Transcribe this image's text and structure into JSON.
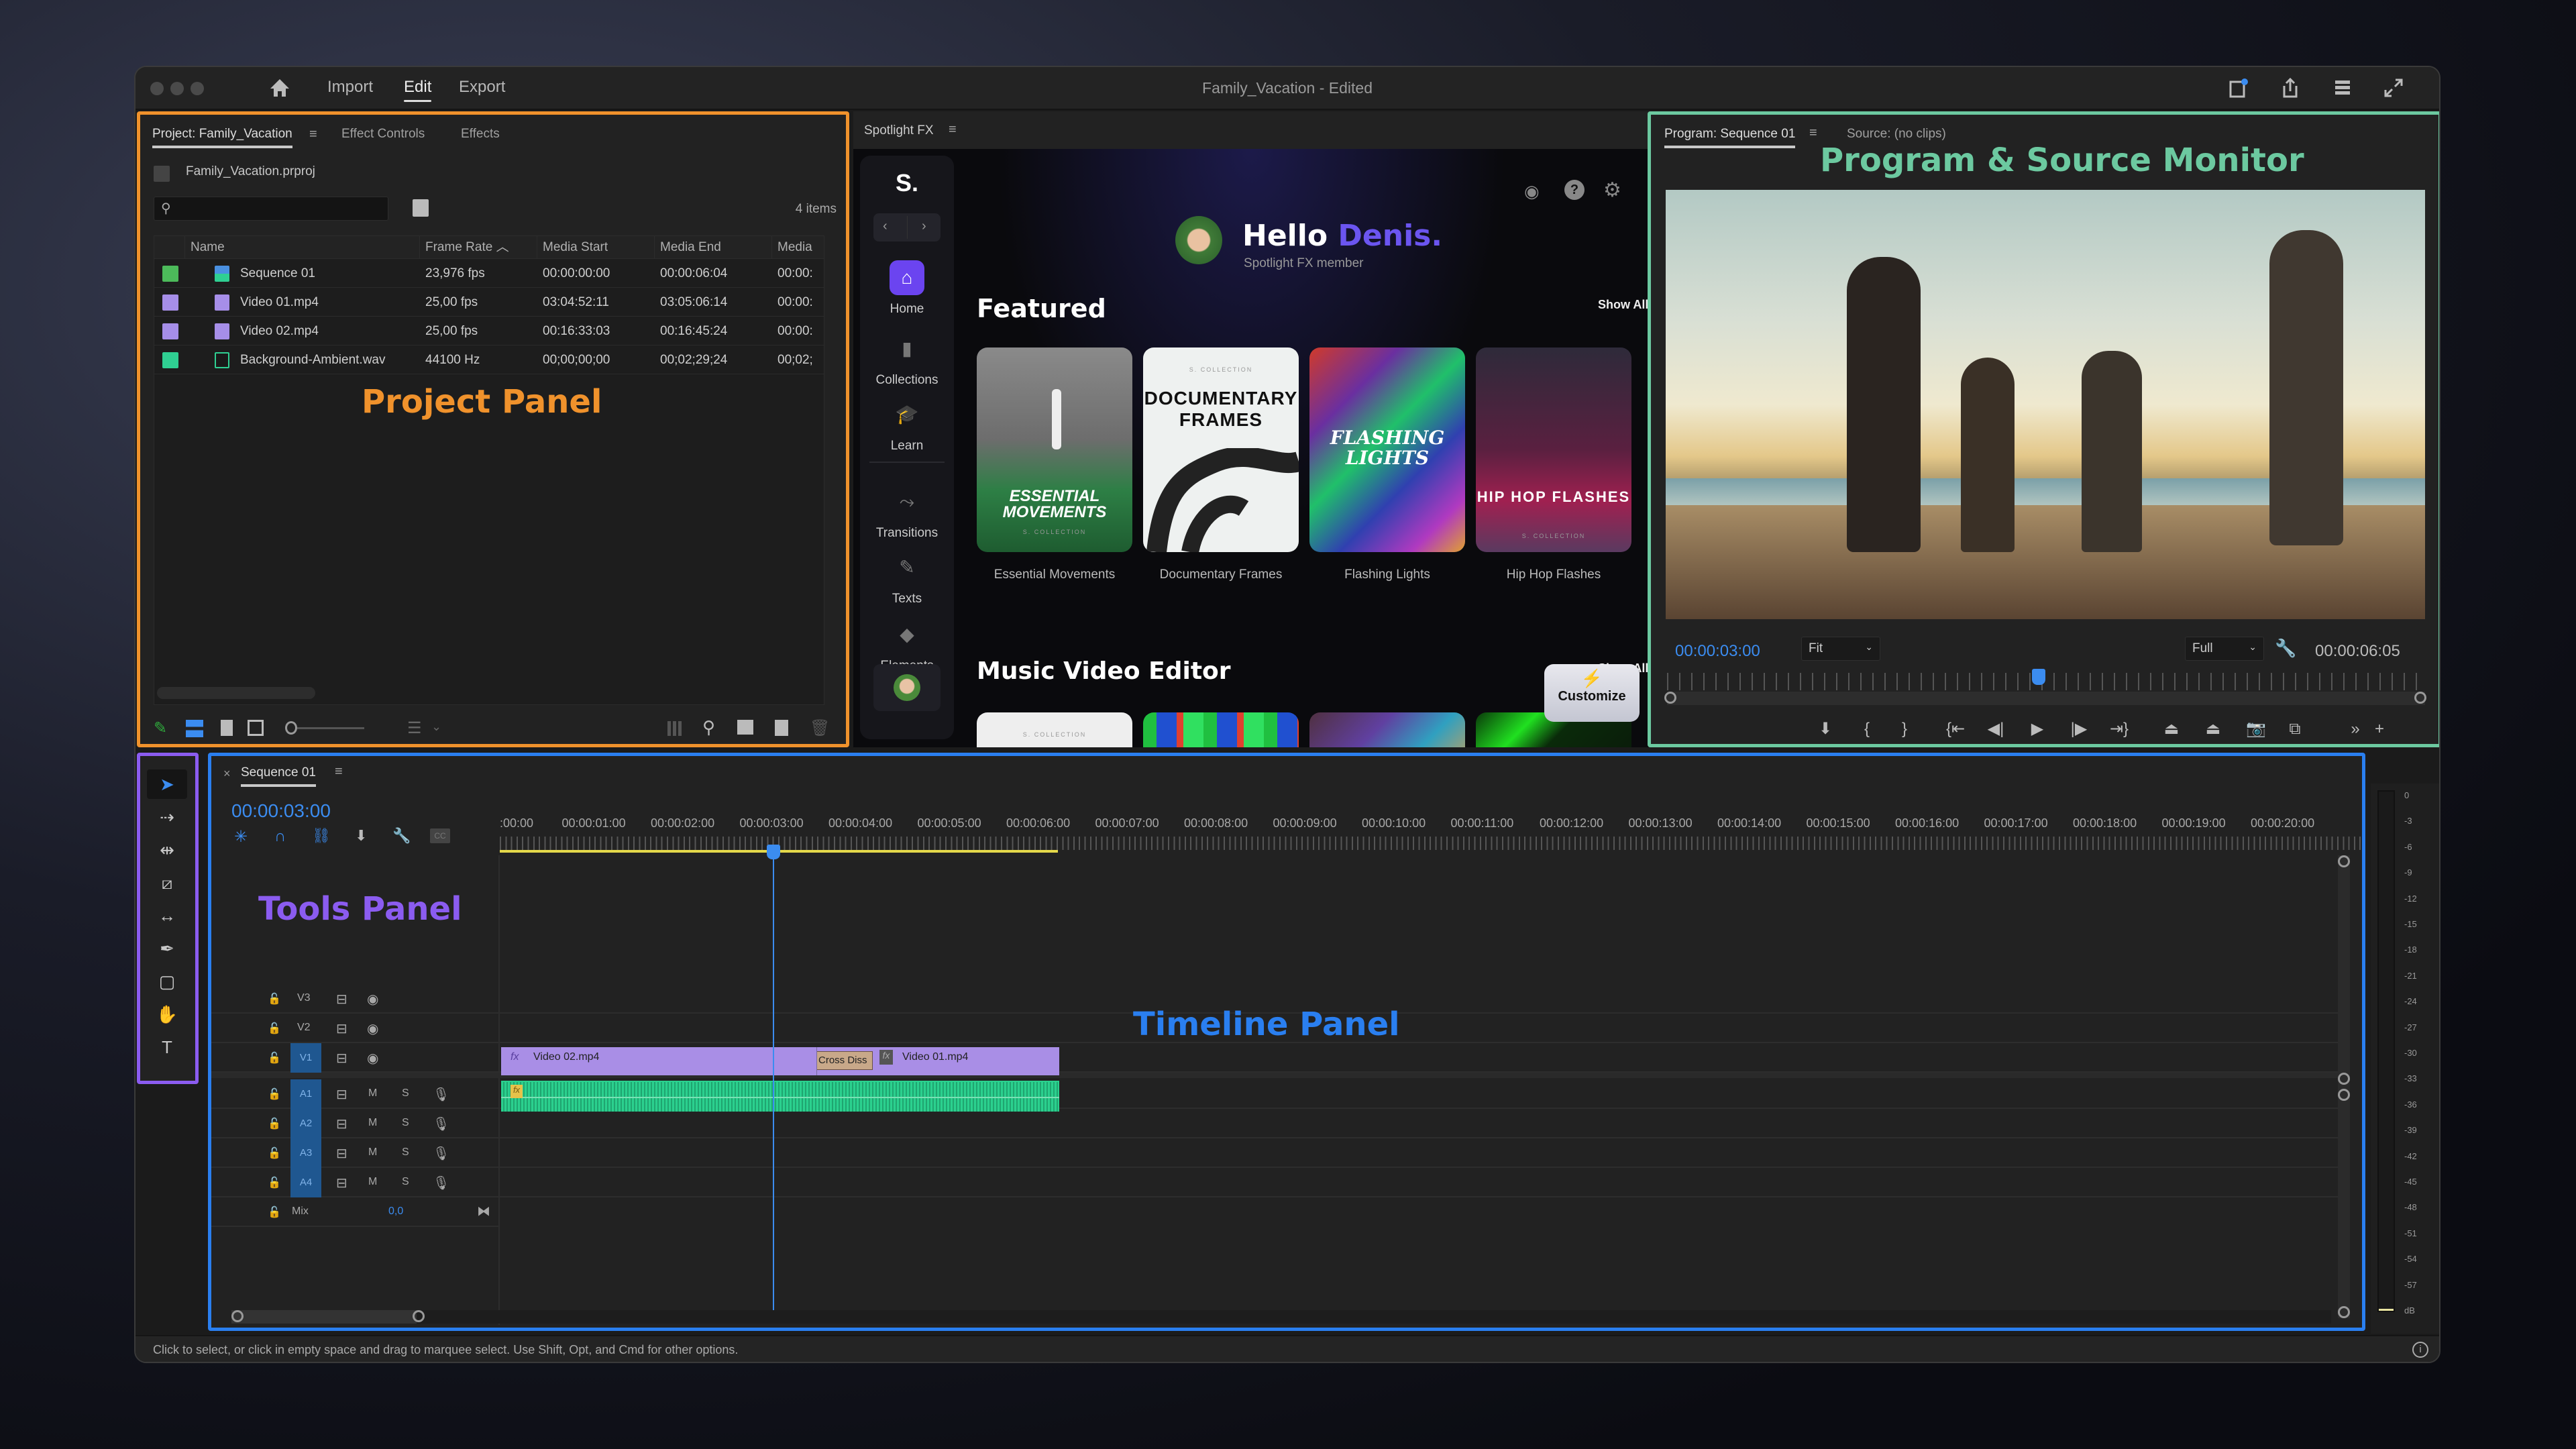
{
  "window": {
    "title": "Family_Vacation - Edited",
    "menu": [
      "Import",
      "Edit",
      "Export"
    ],
    "active_menu": "Edit",
    "toolbar_icons": [
      "quick-export-icon",
      "share-icon",
      "workspaces-icon",
      "fullscreen-icon"
    ]
  },
  "annotations": {
    "project": {
      "label": "Project Panel",
      "color": "#f0922c"
    },
    "monitor": {
      "label": "Program & Source Monitor",
      "color": "#6cc9a0"
    },
    "tools": {
      "label": "Tools Panel",
      "color": "#8b5cf0"
    },
    "timeline": {
      "label": "Timeline Panel",
      "color": "#2a7ff0"
    }
  },
  "project_panel": {
    "tabs": [
      "Project: Family_Vacation",
      "Effect Controls",
      "Effects"
    ],
    "active_tab": "Project: Family_Vacation",
    "project_file": "Family_Vacation.prproj",
    "search_placeholder": "",
    "item_count": "4 items",
    "columns": [
      "Name",
      "Frame Rate",
      "Media Start",
      "Media End",
      "Media"
    ],
    "sort_column": "Frame Rate",
    "rows": [
      {
        "color": "#4cba5a",
        "icon": "sequence-icon",
        "name": "Sequence 01",
        "frame_rate": "23,976 fps",
        "media_start": "00:00:00:00",
        "media_end": "00:00:06:04",
        "media": "00:00:"
      },
      {
        "color": "#a68ee8",
        "icon": "video-clip-icon",
        "name": "Video 01.mp4",
        "frame_rate": "25,00 fps",
        "media_start": "03:04:52:11",
        "media_end": "03:05:06:14",
        "media": "00:00:"
      },
      {
        "color": "#a68ee8",
        "icon": "video-clip-icon",
        "name": "Video 02.mp4",
        "frame_rate": "25,00 fps",
        "media_start": "00:16:33:03",
        "media_end": "00:16:45:24",
        "media": "00:00:"
      },
      {
        "color": "#2fcf92",
        "icon": "audio-clip-icon",
        "name": "Background-Ambient.wav",
        "frame_rate": "44100 Hz",
        "media_start": "00;00;00;00",
        "media_end": "00;02;29;24",
        "media": "00;02;"
      }
    ]
  },
  "spotlight": {
    "tab": "Spotlight FX",
    "logo": "S.",
    "nav": [
      {
        "label": "Home",
        "icon": "home-icon",
        "active": true
      },
      {
        "label": "Collections",
        "icon": "collections-icon"
      },
      {
        "label": "Learn",
        "icon": "learn-icon"
      },
      {
        "label": "Transitions",
        "icon": "transitions-icon"
      },
      {
        "label": "Texts",
        "icon": "texts-icon"
      },
      {
        "label": "Elements",
        "icon": "elements-icon"
      }
    ],
    "greeting_prefix": "Hello",
    "greeting_name": "Denis.",
    "member_text": "Spotlight FX member",
    "featured_title": "Featured",
    "show_all": "Show All",
    "featured": [
      {
        "label": "Essential Movements",
        "title": "ESSENTIAL MOVEMENTS"
      },
      {
        "label": "Documentary Frames",
        "title": "DOCUMENTARY FRAMES"
      },
      {
        "label": "Flashing Lights",
        "title": "FLASHING LIGHTS"
      },
      {
        "label": "Hip Hop Flashes",
        "title": "HIP HOP FLASHES"
      }
    ],
    "collection_tag": "S. COLLECTION",
    "music_title": "Music Video Editor",
    "customize_label": "Customize"
  },
  "monitor": {
    "tabs": [
      "Program: Sequence 01",
      "Source: (no clips)"
    ],
    "active_tab": "Program: Sequence 01",
    "current_time": "00:00:03:00",
    "zoom_select": "Fit",
    "quality_select": "Full",
    "duration": "00:00:06:05",
    "playhead_fraction": 0.49,
    "controls": [
      "add-marker",
      "mark-in",
      "mark-out",
      "go-to-in",
      "step-back",
      "play",
      "step-forward",
      "go-to-out",
      "lift",
      "extract",
      "export-frame",
      "compare",
      "more",
      "add"
    ]
  },
  "tools": [
    "selection",
    "track-select-forward",
    "ripple-edit",
    "razor",
    "slip",
    "pen",
    "rectangle",
    "hand",
    "type"
  ],
  "timeline": {
    "sequence_name": "Sequence 01",
    "current_time": "00:00:03:00",
    "ruler": [
      ":00:00",
      "00:00:01:00",
      "00:00:02:00",
      "00:00:03:00",
      "00:00:04:00",
      "00:00:05:00",
      "00:00:06:00",
      "00:00:07:00",
      "00:00:08:00",
      "00:00:09:00",
      "00:00:10:00",
      "00:00:11:00",
      "00:00:12:00",
      "00:00:13:00",
      "00:00:14:00",
      "00:00:15:00",
      "00:00:16:00",
      "00:00:17:00",
      "00:00:18:00",
      "00:00:19:00",
      "00:00:20:00"
    ],
    "video_tracks": [
      "V3",
      "V2",
      "V1"
    ],
    "audio_tracks": [
      "A1",
      "A2",
      "A3",
      "A4"
    ],
    "audio_btns": {
      "mute": "M",
      "solo": "S"
    },
    "mix_label": "Mix",
    "mix_value": "0,0",
    "clips": {
      "video_a": "Video 02.mp4",
      "transition": "Cross Diss",
      "video_b": "Video 01.mp4",
      "fx": "fx"
    }
  },
  "meter": {
    "scale": [
      "0",
      "-3",
      "-6",
      "-9",
      "-12",
      "-15",
      "-18",
      "-21",
      "-24",
      "-27",
      "-30",
      "-33",
      "-36",
      "-39",
      "-42",
      "-45",
      "-48",
      "-51",
      "-54",
      "-57",
      "dB"
    ]
  },
  "status_bar": "Click to select, or click in empty space and drag to marquee select. Use Shift, Opt, and Cmd for other options."
}
